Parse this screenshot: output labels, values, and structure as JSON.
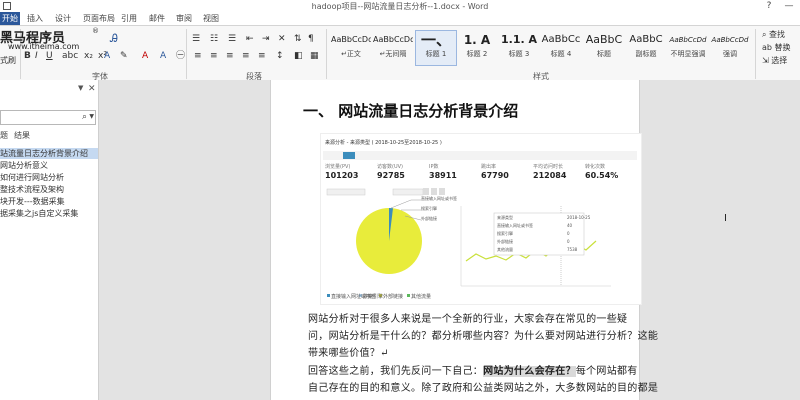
{
  "window": {
    "title": "hadoop项目--网站流量日志分析--1.docx - Word",
    "help": "?",
    "minimize": "—"
  },
  "tabs": [
    "开始",
    "插入",
    "设计",
    "页面布局",
    "引用",
    "邮件",
    "审阅",
    "视图"
  ],
  "logo": {
    "name": "黑马程序员",
    "url": "www.itheima.com",
    "trademark": "®"
  },
  "ribbon": {
    "format_painter": "式刷",
    "font_group": "字体",
    "paragraph_group": "段落",
    "styles_group": "样式",
    "bold": "B",
    "italic": "I",
    "underline": "U",
    "styles": [
      {
        "preview": "AaBbCcDd",
        "name": "↵正文"
      },
      {
        "preview": "AaBbCcDd",
        "name": "↵无间隔"
      },
      {
        "preview": "一、",
        "name": "标题 1"
      },
      {
        "preview": "1.  A",
        "name": "标题 2"
      },
      {
        "preview": "1.1.  A",
        "name": "标题 3"
      },
      {
        "preview": "AaBbCc",
        "name": "标题 4"
      },
      {
        "preview": "AaBbC",
        "name": "标题"
      },
      {
        "preview": "AaBbC",
        "name": "副标题"
      },
      {
        "preview": "AaBbCcDd",
        "name": "不明显强调"
      },
      {
        "preview": "AaBbCcDd",
        "name": "强调"
      }
    ],
    "editing": [
      "查找",
      "替换",
      "选择"
    ]
  },
  "nav": {
    "search_placeholder": "",
    "tabs": [
      "题",
      "结果"
    ],
    "items": [
      "站流量日志分析背景介绍",
      "网站分析意义",
      "如何进行网站分析",
      "整技术流程及架构",
      "块开发---数据采集",
      "据采集之js自定义采集"
    ]
  },
  "doc": {
    "heading": "一、  网站流量日志分析背景介绍",
    "p1_l1": "网站分析对于很多人来说是一个全新的行业，大家会存在常见的一些疑",
    "p1_l2": "问，网站分析是干什么的？都分析哪些内容？为什么要对网站进行分析？这能",
    "p1_l3": "带来哪些价值？↵",
    "p2_l1a": "回答这些之前，我们先反问一下自己：",
    "p2_l1b": "网站为什么会存在？",
    "p2_l1c": "每个网站都有",
    "p2_l2": "自己存在的目的和意义。除了政府和公益类网站之外，大多数网站的目的都是"
  },
  "screenshot": {
    "header": "来源分析 - 来源类型 ( 2018-10-25至2018-10-25 )",
    "metrics": [
      {
        "label": "浏览量(PV)",
        "value": "101203"
      },
      {
        "label": "访客数(UV)",
        "value": "92785"
      },
      {
        "label": "IP数",
        "value": "38911"
      },
      {
        "label": "跳出率",
        "value": "67790"
      },
      {
        "label": "平均访问时长",
        "value": "212084"
      },
      {
        "label": "转化次数",
        "value": "60.54%"
      }
    ],
    "legend": [
      "直接输入网址或书签",
      "搜索引擎",
      "外部链接",
      "其他流量"
    ],
    "tooltip": [
      {
        "k": "来源类型",
        "v": "2018-10-25"
      },
      {
        "k": "直接输入网址或书签",
        "v": "40"
      },
      {
        "k": "搜索引擎",
        "v": "0"
      },
      {
        "k": "外部链接",
        "v": "0"
      },
      {
        "k": "其他流量",
        "v": "7538"
      }
    ],
    "colors": {
      "pie": "#e8ec3b",
      "line": "#c9e03a",
      "accent": "#3c8dbc"
    }
  }
}
